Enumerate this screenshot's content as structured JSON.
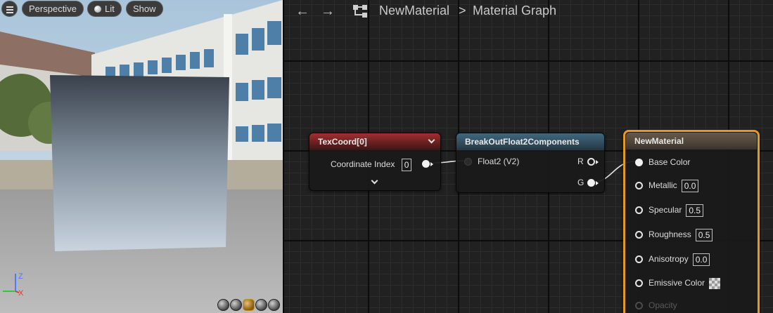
{
  "viewport": {
    "menu_icon": "hamburger-icon",
    "perspective_label": "Perspective",
    "lit_label": "Lit",
    "show_label": "Show",
    "axis": {
      "z_label": "Z",
      "x_label": "X"
    },
    "preview_shapes": [
      "cylinder",
      "sphere",
      "plane",
      "cube",
      "custom-mesh"
    ]
  },
  "graph_header": {
    "back_icon": "arrow-left-icon",
    "forward_icon": "arrow-right-icon",
    "hierarchy_icon": "graph-hierarchy-icon",
    "breadcrumb": {
      "asset": "NewMaterial",
      "separator": ">",
      "graph": "Material Graph"
    }
  },
  "nodes": {
    "texcoord": {
      "title": "TexCoord[0]",
      "param_label": "Coordinate Index",
      "param_value": "0"
    },
    "breakout": {
      "title": "BreakOutFloat2Components",
      "input_label": "Float2 (V2)",
      "output_r": "R",
      "output_g": "G"
    },
    "material": {
      "title": "NewMaterial",
      "inputs": [
        {
          "label": "Base Color",
          "value": ""
        },
        {
          "label": "Metallic",
          "value": "0.0"
        },
        {
          "label": "Specular",
          "value": "0.5"
        },
        {
          "label": "Roughness",
          "value": "0.5"
        },
        {
          "label": "Anisotropy",
          "value": "0.0"
        },
        {
          "label": "Emissive Color",
          "value": ""
        },
        {
          "label": "Opacity",
          "value": ""
        }
      ]
    }
  },
  "colors": {
    "texcoord_title": "#a13030",
    "breakout_title": "#3e6880",
    "material_title": "#675a4a",
    "selection": "#e29a1f"
  }
}
